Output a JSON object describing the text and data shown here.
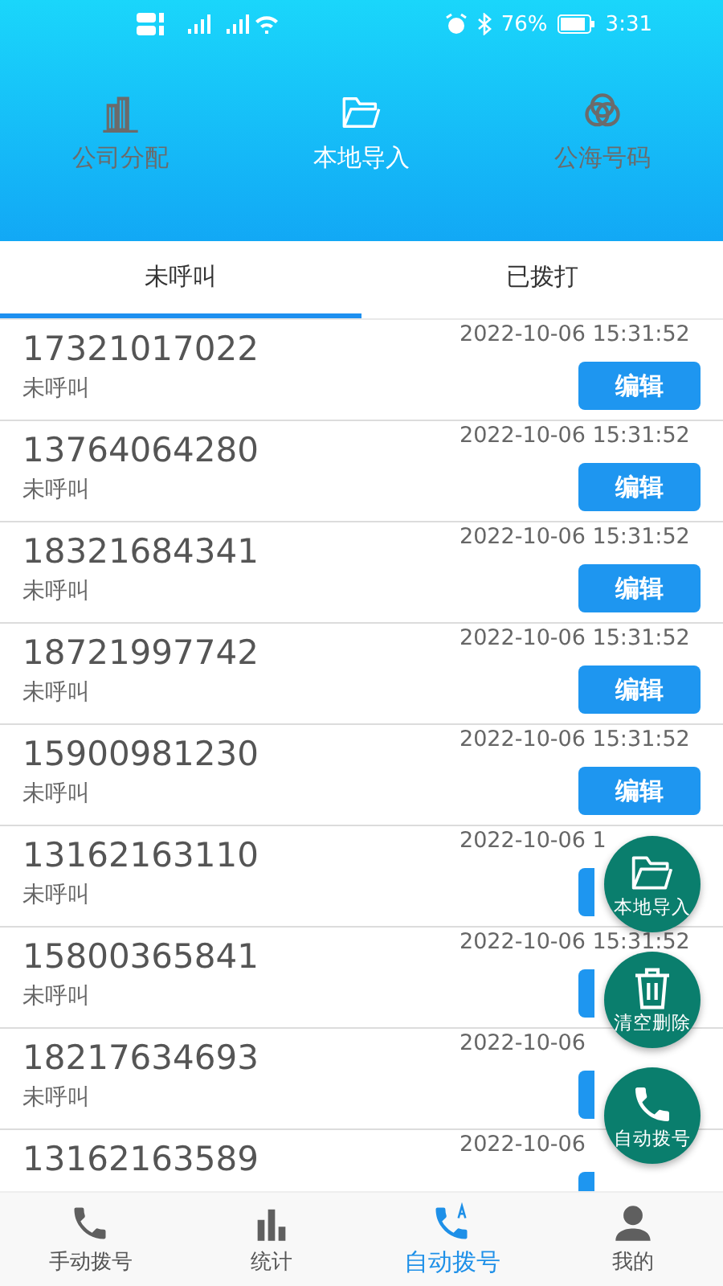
{
  "status_bar": {
    "battery": "76%",
    "time": "3:31"
  },
  "top_nav": [
    {
      "label": "公司分配",
      "selected": false
    },
    {
      "label": "本地导入",
      "selected": true
    },
    {
      "label": "公海号码",
      "selected": false
    }
  ],
  "tabs": [
    {
      "label": "未呼叫",
      "selected": true
    },
    {
      "label": "已拨打",
      "selected": false
    }
  ],
  "rows": [
    {
      "phone": "17321017022",
      "status": "未呼叫",
      "time": "2022-10-06 15:31:52",
      "button": "编辑"
    },
    {
      "phone": "13764064280",
      "status": "未呼叫",
      "time": "2022-10-06 15:31:52",
      "button": "编辑"
    },
    {
      "phone": "18321684341",
      "status": "未呼叫",
      "time": "2022-10-06 15:31:52",
      "button": "编辑"
    },
    {
      "phone": "18721997742",
      "status": "未呼叫",
      "time": "2022-10-06 15:31:52",
      "button": "编辑"
    },
    {
      "phone": "15900981230",
      "status": "未呼叫",
      "time": "2022-10-06 15:31:52",
      "button": "编辑"
    },
    {
      "phone": "13162163110",
      "status": "未呼叫",
      "time": "2022-10-06 1"
    },
    {
      "phone": "15800365841",
      "status": "未呼叫",
      "time": "2022-10-06 15:31:52"
    },
    {
      "phone": "18217634693",
      "status": "未呼叫",
      "time": "2022-10-06"
    },
    {
      "phone": "13162163589",
      "time": "2022-10-06"
    }
  ],
  "fabs": [
    {
      "label": "本地导入"
    },
    {
      "label": "清空删除"
    },
    {
      "label": "自动拨号"
    }
  ],
  "bottom_nav": [
    {
      "label": "手动拨号",
      "selected": false
    },
    {
      "label": "统计",
      "selected": false
    },
    {
      "label": "自动拨号",
      "selected": true
    },
    {
      "label": "我的",
      "selected": false
    }
  ]
}
